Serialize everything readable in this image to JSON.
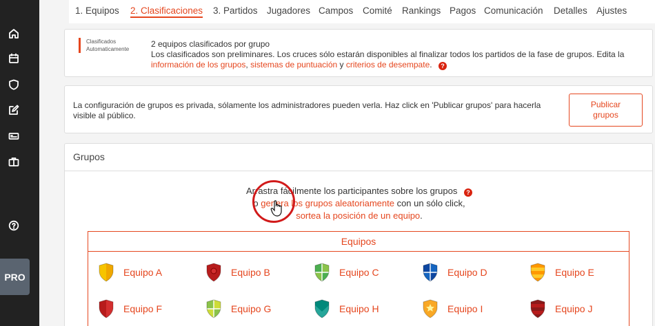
{
  "sidebar": {
    "icons": [
      "home-icon",
      "calendar-icon",
      "shield-icon",
      "edit-icon",
      "ticket-icon",
      "briefcase-icon",
      "help-icon"
    ],
    "pro_label": "PRO"
  },
  "tabs": [
    {
      "label": "1. Equipos",
      "active": false
    },
    {
      "label": "2. Clasificaciones",
      "active": true
    },
    {
      "label": "3. Partidos",
      "active": false
    },
    {
      "label": "Jugadores",
      "active": false
    },
    {
      "label": "Campos",
      "active": false
    },
    {
      "label": "Comité",
      "active": false
    },
    {
      "label": "Rankings",
      "active": false
    },
    {
      "label": "Pagos",
      "active": false
    },
    {
      "label": "Comunicación",
      "active": false
    },
    {
      "label": "Detalles",
      "active": false
    },
    {
      "label": "Ajustes",
      "active": false
    }
  ],
  "qualifiers": {
    "tag_line1": "Clasificados",
    "tag_line2": "Automaticamente",
    "line1": "2 equipos clasificados por grupo",
    "line2": "Los clasificados son preliminares. Los cruces sólo estarán disponibles al finalizar todos los partidos de la fase de grupos. Edita la",
    "link_groups": "información de los grupos",
    "sep1": ", ",
    "link_scoring": "sistemas de puntuación",
    "sep2": " y ",
    "link_tiebreak": "criterios de desempate",
    "end": ".",
    "help": "?"
  },
  "publish": {
    "text": "La configuración de grupos es privada, sólamente los administradores pueden verla. Haz click en 'Publicar grupos' para hacerla visible al público.",
    "button_line1": "Publicar",
    "button_line2": "grupos"
  },
  "groups": {
    "header": "Grupos",
    "instr_line1": "Arrastra fácilmente los participantes sobre los grupos",
    "instr_or": "o ",
    "instr_random_link": "genera los grupos aleatoriamente",
    "instr_line2_rest": " con un sólo click,",
    "instr_line3_link": "sortea la posición de un equipo",
    "instr_line3_end": ".",
    "help": "?",
    "teams_title": "Equipos",
    "teams": [
      {
        "name": "Equipo A",
        "color1": "#f7c400",
        "color2": "#f0a800",
        "pattern": "split"
      },
      {
        "name": "Equipo B",
        "color1": "#b71c1c",
        "color2": "#d32f2f",
        "pattern": "ring"
      },
      {
        "name": "Equipo C",
        "color1": "#4caf50",
        "color2": "#8bc34a",
        "pattern": "quarter"
      },
      {
        "name": "Equipo D",
        "color1": "#0d47a1",
        "color2": "#1565c0",
        "pattern": "quarter"
      },
      {
        "name": "Equipo E",
        "color1": "#ff9800",
        "color2": "#ffca28",
        "pattern": "stripes"
      },
      {
        "name": "Equipo F",
        "color1": "#b71c1c",
        "color2": "#d32f2f",
        "pattern": "split"
      },
      {
        "name": "Equipo G",
        "color1": "#8bc34a",
        "color2": "#cddc39",
        "pattern": "quarter"
      },
      {
        "name": "Equipo H",
        "color1": "#00897b",
        "color2": "#26a69a",
        "pattern": "chevron"
      },
      {
        "name": "Equipo I",
        "color1": "#f9a825",
        "color2": "#fdd835",
        "pattern": "star"
      },
      {
        "name": "Equipo J",
        "color1": "#8b1a1a",
        "color2": "#b71c1c",
        "pattern": "stripes"
      }
    ]
  }
}
